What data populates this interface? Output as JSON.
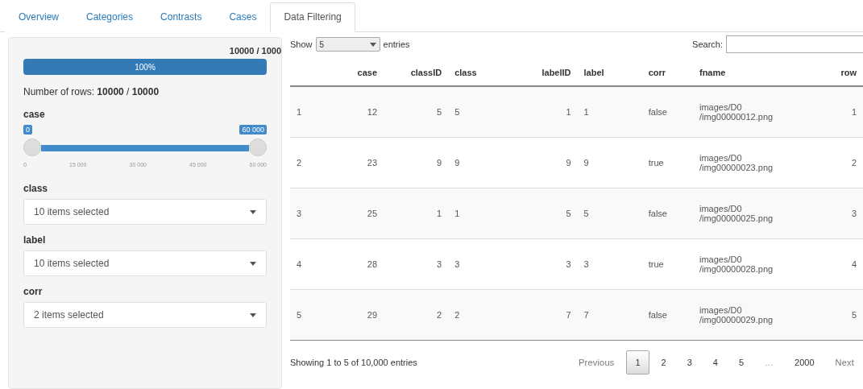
{
  "tabs": [
    {
      "label": "Overview",
      "selected": false
    },
    {
      "label": "Categories",
      "selected": false
    },
    {
      "label": "Contrasts",
      "selected": false
    },
    {
      "label": "Cases",
      "selected": false
    },
    {
      "label": "Data Filtering",
      "selected": true
    }
  ],
  "sidebar": {
    "progress": {
      "count": "10000 / 1000",
      "level": 1,
      "label": "100%"
    },
    "rows_text": "Number of rows: **10000** / **10000**",
    "case_slider": {
      "label": "case",
      "min_label": "0",
      "max_label": "60 000",
      "ticks": [
        "0",
        "15 000",
        "30 000",
        "45 000",
        "60 000"
      ]
    },
    "filters": [
      {
        "label": "class",
        "value": "10 items selected"
      },
      {
        "label": "label",
        "value": "10 items selected"
      },
      {
        "label": "corr",
        "value": "2 items selected"
      }
    ]
  },
  "table": {
    "show_label": "Show",
    "length_value": "5",
    "entries_label": "entries",
    "search_label": "Search:",
    "columns": [
      "",
      "case",
      "classID",
      "class",
      "labelID",
      "label",
      "corr",
      "fname",
      "row"
    ],
    "rows": [
      [
        "1",
        "12",
        "5",
        "5",
        "1",
        "1",
        "false",
        "images/D0 /img00000012.png",
        "1"
      ],
      [
        "2",
        "23",
        "9",
        "9",
        "9",
        "9",
        "true",
        "images/D0 /img00000023.png",
        "2"
      ],
      [
        "3",
        "25",
        "1",
        "1",
        "5",
        "5",
        "false",
        "images/D0 /img00000025.png",
        "3"
      ],
      [
        "4",
        "28",
        "3",
        "3",
        "3",
        "3",
        "true",
        "images/D0 /img00000028.png",
        "4"
      ],
      [
        "5",
        "29",
        "2",
        "2",
        "7",
        "7",
        "false",
        "images/D0 /img00000029.png",
        "5"
      ]
    ],
    "info": "Showing 1 to 5 of 10,000 entries",
    "pagination": [
      {
        "label": "Previous",
        "kind": "nav",
        "selected": false
      },
      {
        "label": "1",
        "kind": "page",
        "selected": true
      },
      {
        "label": "2",
        "kind": "page",
        "selected": false
      },
      {
        "label": "3",
        "kind": "page",
        "selected": false
      },
      {
        "label": "4",
        "kind": "page",
        "selected": false
      },
      {
        "label": "5",
        "kind": "page",
        "selected": false
      },
      {
        "label": "…",
        "kind": "ellipsis",
        "selected": false
      },
      {
        "label": "2000",
        "kind": "page",
        "selected": false
      },
      {
        "label": "Next",
        "kind": "nav",
        "selected": false
      }
    ]
  }
}
